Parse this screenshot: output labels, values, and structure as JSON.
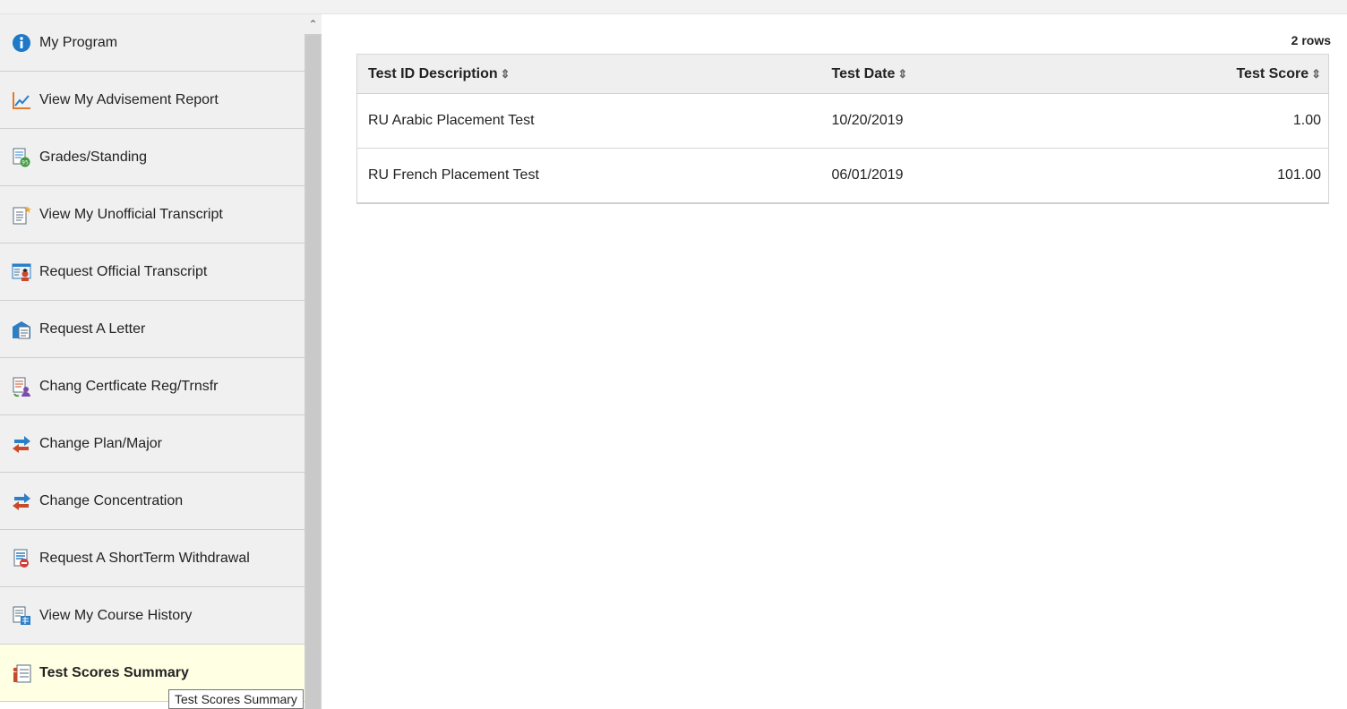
{
  "sidebar": {
    "items": [
      {
        "label": "My Program",
        "icon": "info-icon"
      },
      {
        "label": "View My Advisement Report",
        "icon": "chart-icon"
      },
      {
        "label": "Grades/Standing",
        "icon": "grades-icon"
      },
      {
        "label": "View My Unofficial Transcript",
        "icon": "transcript-icon"
      },
      {
        "label": "Request Official Transcript",
        "icon": "official-transcript-icon"
      },
      {
        "label": "Request A Letter",
        "icon": "letter-icon"
      },
      {
        "label": "Chang Certficate Reg/Trnsfr",
        "icon": "certificate-icon"
      },
      {
        "label": "Change Plan/Major",
        "icon": "swap-arrows-icon"
      },
      {
        "label": "Change Concentration",
        "icon": "swap-arrows-icon"
      },
      {
        "label": "Request A ShortTerm Withdrawal",
        "icon": "withdrawal-icon"
      },
      {
        "label": "View My Course History",
        "icon": "course-history-icon"
      },
      {
        "label": "Test Scores Summary",
        "icon": "test-scores-icon",
        "selected": true
      }
    ],
    "tooltip": "Test Scores Summary"
  },
  "main": {
    "row_count": "2 rows",
    "columns": [
      "Test ID Description",
      "Test Date",
      "Test Score"
    ],
    "rows": [
      [
        "RU Arabic Placement Test",
        "10/20/2019",
        "1.00"
      ],
      [
        "RU French Placement Test",
        "06/01/2019",
        "101.00"
      ]
    ]
  }
}
